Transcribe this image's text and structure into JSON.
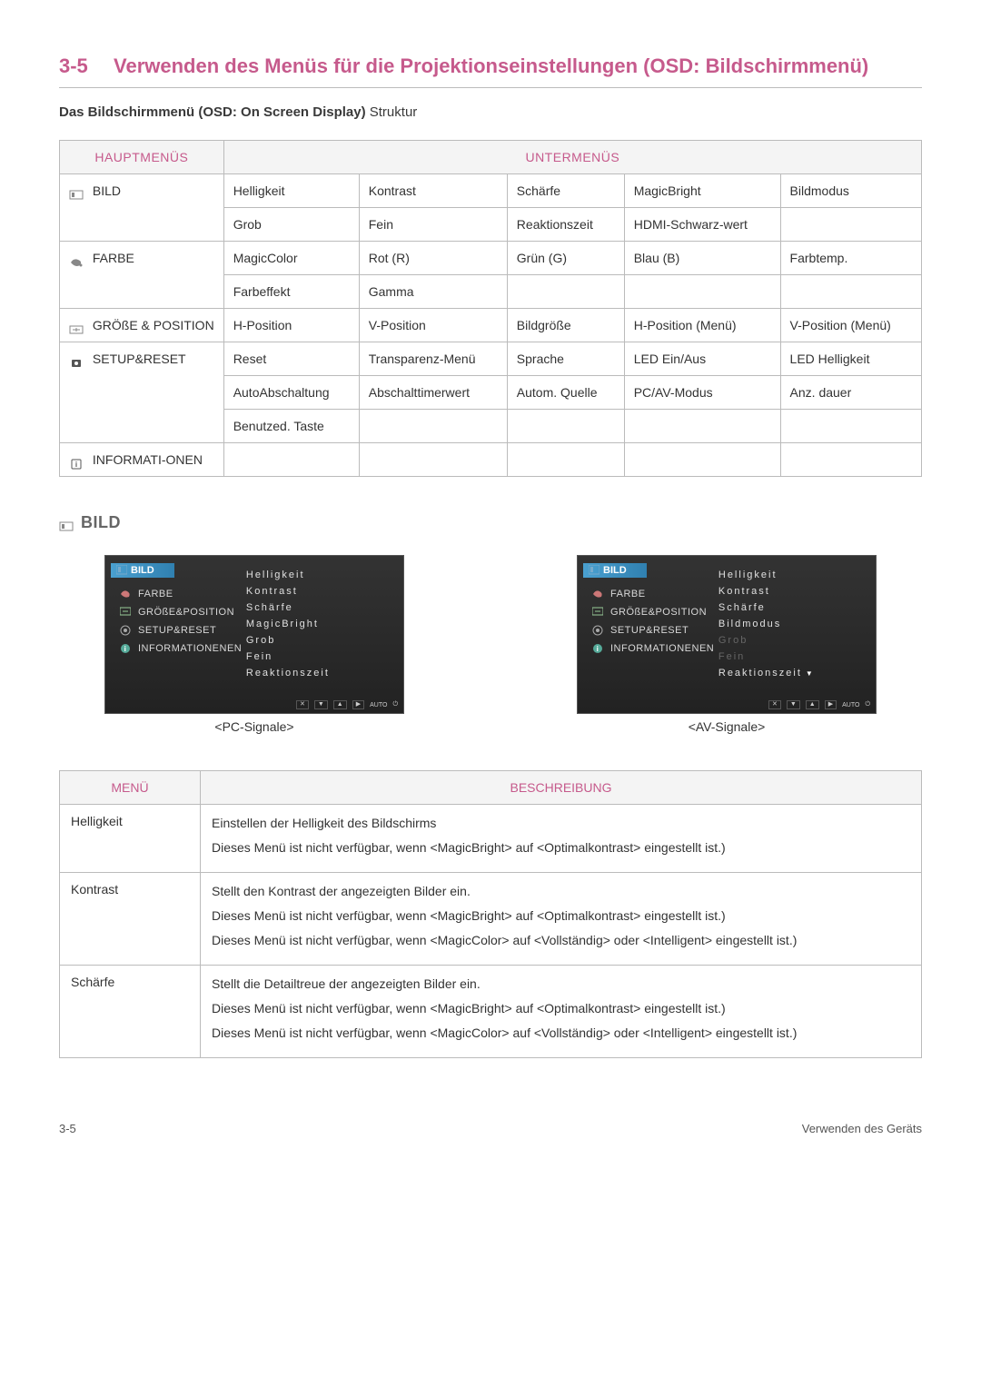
{
  "heading": {
    "num": "3-5",
    "title": "Verwenden des Menüs für die Projektionseinstellungen (OSD: Bildschirmmenü)"
  },
  "subheading": {
    "bold": "Das Bildschirmmenü (OSD: On Screen Display)",
    "rest": " Struktur"
  },
  "structure": {
    "col_main": "HAUPTMENÜS",
    "col_sub": "UNTERMENÜS",
    "groups": [
      {
        "main": "BILD",
        "icon": "bild-icon",
        "rows": [
          [
            "Helligkeit",
            "Kontrast",
            "Schärfe",
            "MagicBright",
            "Bildmodus"
          ],
          [
            "Grob",
            "Fein",
            "Reaktionszeit",
            "HDMI-Schwarz-wert",
            ""
          ]
        ]
      },
      {
        "main": "FARBE",
        "icon": "farbe-icon",
        "rows": [
          [
            "MagicColor",
            "Rot (R)",
            "Grün (G)",
            "Blau (B)",
            "Farbtemp."
          ],
          [
            "Farbeffekt",
            "Gamma",
            "",
            "",
            ""
          ]
        ]
      },
      {
        "main": "GRÖßE & POSITION",
        "icon": "size-icon",
        "rows": [
          [
            "H-Position",
            "V-Position",
            "Bildgröße",
            "H-Position (Menü)",
            "V-Position (Menü)"
          ]
        ]
      },
      {
        "main": "SETUP&RESET",
        "icon": "setup-icon",
        "rows": [
          [
            "Reset",
            "Transparenz-Menü",
            "Sprache",
            "LED Ein/Aus",
            "LED Helligkeit"
          ],
          [
            "AutoAbschaltung",
            "Abschalttimerwert",
            "Autom. Quelle",
            "PC/AV-Modus",
            "Anz. dauer"
          ],
          [
            "Benutzed. Taste",
            "",
            "",
            "",
            ""
          ]
        ]
      },
      {
        "main": "INFORMATI-ONEN",
        "icon": "info-icon",
        "rows": [
          [
            "",
            "",
            "",
            "",
            ""
          ]
        ]
      }
    ]
  },
  "bild_section": {
    "title": "BILD"
  },
  "panels": {
    "menu": {
      "bild": "BILD",
      "farbe": "FARBE",
      "groesse": "GRÖßE&POSITION",
      "setup": "SETUP&RESET",
      "info": "INFORMATIONENEN"
    },
    "left": {
      "items": [
        "Helligkeit",
        "Kontrast",
        "Schärfe",
        "MagicBright",
        "Grob",
        "Fein",
        "Reaktionszeit"
      ],
      "caption": "<PC-Signale>"
    },
    "right": {
      "items": [
        {
          "t": "Helligkeit",
          "dim": false
        },
        {
          "t": "Kontrast",
          "dim": false
        },
        {
          "t": "Schärfe",
          "dim": false
        },
        {
          "t": "Bildmodus",
          "dim": false
        },
        {
          "t": "Grob",
          "dim": true
        },
        {
          "t": "Fein",
          "dim": true
        },
        {
          "t": "Reaktionszeit",
          "dim": false,
          "arrow": true
        }
      ],
      "caption": "<AV-Signale>"
    },
    "bottom_auto": "AUTO"
  },
  "desc": {
    "col_m": "MENÜ",
    "col_b": "BESCHREIBUNG",
    "rows": [
      {
        "m": "Helligkeit",
        "p": [
          "Einstellen der Helligkeit des Bildschirms",
          "Dieses Menü ist nicht verfügbar, wenn <MagicBright> auf <Optimalkontrast> eingestellt ist.)"
        ]
      },
      {
        "m": "Kontrast",
        "p": [
          "Stellt den Kontrast der angezeigten Bilder ein.",
          "Dieses Menü ist nicht verfügbar, wenn <MagicBright> auf <Optimalkontrast> eingestellt ist.)",
          "Dieses Menü ist nicht verfügbar, wenn <MagicColor> auf <Vollständig> oder <Intelligent> eingestellt ist.)"
        ]
      },
      {
        "m": "Schärfe",
        "p": [
          "Stellt die Detailtreue der angezeigten Bilder ein.",
          "Dieses Menü ist nicht verfügbar, wenn <MagicBright> auf <Optimalkontrast> eingestellt ist.)",
          "Dieses Menü ist nicht verfügbar, wenn <MagicColor> auf <Vollständig> oder <Intelligent> eingestellt ist.)"
        ]
      }
    ]
  },
  "footer": {
    "left": "3-5",
    "right": "Verwenden des Geräts"
  }
}
